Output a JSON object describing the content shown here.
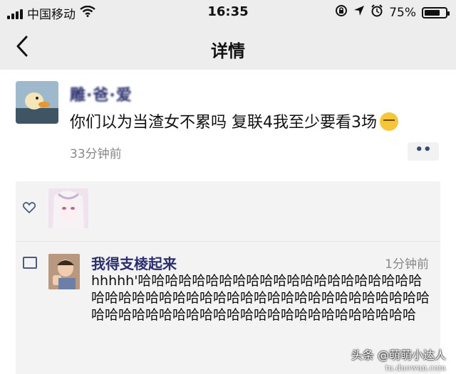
{
  "status_bar": {
    "carrier": "中国移动",
    "time": "16:35",
    "battery_text": "75%",
    "battery_level": 0.75,
    "icons": [
      "signal-icon",
      "wifi-icon",
      "orientation-lock-icon",
      "location-icon",
      "alarm-icon",
      "battery-icon"
    ]
  },
  "nav": {
    "back_icon": "chevron-left-icon",
    "title": "详情"
  },
  "post": {
    "user_name": "雕·爸·爱",
    "text": "你们以为当渣女不累吗 复联4我至少要看3场",
    "emoji": "smirk-face",
    "time": "33分钟前",
    "more_label": "••"
  },
  "likes": {
    "icon": "heart-icon"
  },
  "comment": {
    "icon": "comment-icon",
    "user_name": "我得支棱起来",
    "time": "1分钟前",
    "text": "hhhhh'哈哈哈哈哈哈哈哈哈哈哈哈哈哈哈哈哈哈哈哈哈哈哈哈哈哈哈哈哈哈哈哈哈哈哈哈哈哈哈哈哈哈哈哈哈哈哈哈哈哈哈哈哈哈哈哈哈哈哈哈哈哈哈哈哈哈哈哈哈哈"
  },
  "watermark": {
    "text": "头条 @萌萌小达人",
    "sub": "tu.duowan.com"
  },
  "colors": {
    "bar_bg": "#ededed",
    "name_color": "#2b2f6e",
    "meta_gray": "#888888",
    "panel_bg": "#f3f3f3"
  }
}
